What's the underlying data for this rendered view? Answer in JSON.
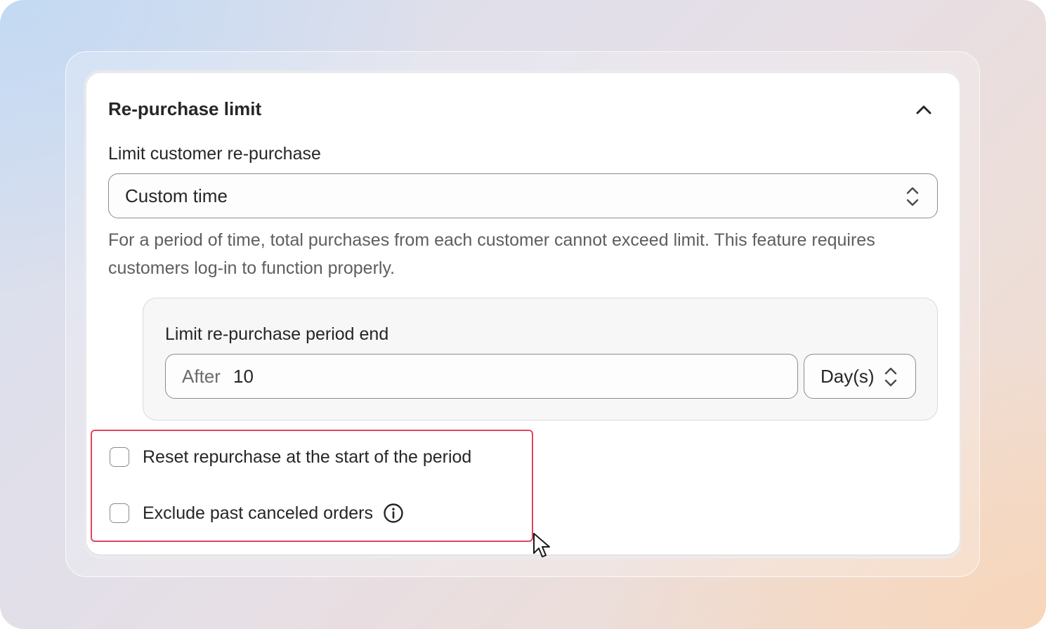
{
  "card": {
    "title": "Re-purchase limit",
    "collapse_icon": "chevron-up-icon"
  },
  "limit": {
    "label": "Limit customer re-purchase",
    "selected": "Custom time",
    "select_icon": "select-updown-icon",
    "help_text": "For a period of time, total purchases from each customer cannot exceed limit. This feature requires customers log-in to function properly."
  },
  "period": {
    "label": "Limit re-purchase period end",
    "prefix": "After",
    "value": "10",
    "unit": "Day(s)"
  },
  "options": {
    "reset_label": "Reset repurchase at the start of the period",
    "reset_checked": false,
    "exclude_label": "Exclude past canceled orders",
    "exclude_checked": false,
    "info_icon": "info-circle-icon"
  },
  "colors": {
    "highlight": "#e0455b",
    "text": "#262626",
    "muted_text": "#5e5e5e"
  }
}
